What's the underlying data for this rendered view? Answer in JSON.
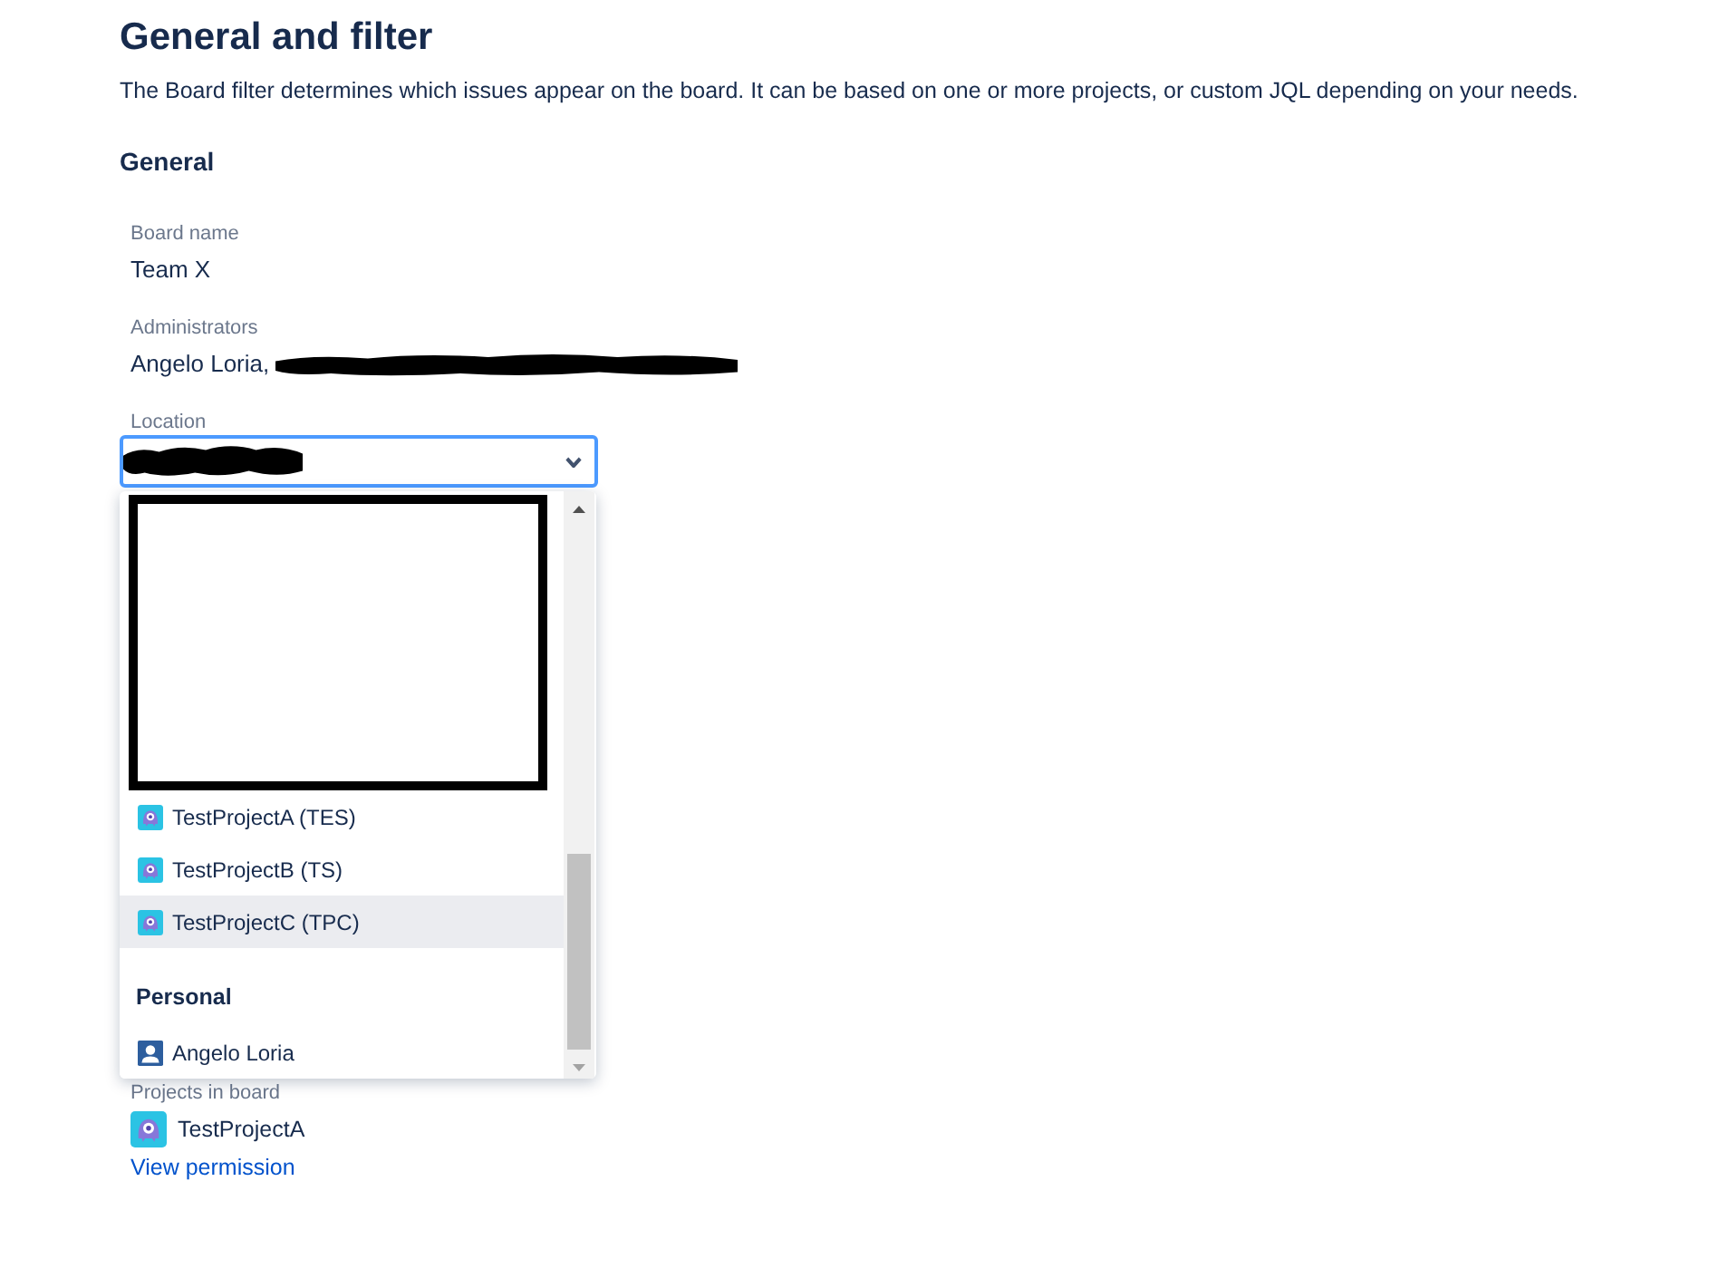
{
  "page": {
    "title": "General and filter",
    "description": "The Board filter determines which issues appear on the board. It can be based on one or more projects, or custom JQL depending on your needs."
  },
  "section": {
    "title": "General"
  },
  "fields": [
    {
      "kind": "text",
      "label": "Board name",
      "value": "Team X"
    },
    {
      "kind": "text",
      "label": "Administrators",
      "value": "Angelo Loria,",
      "redacted": true
    },
    {
      "kind": "select",
      "label": "Location",
      "redacted": true,
      "expanded": true
    }
  ],
  "location_menu": {
    "options": [
      {
        "kind": "redacted"
      },
      {
        "kind": "project",
        "label": "TestProjectA (TES)",
        "selected": false
      },
      {
        "kind": "project",
        "label": "TestProjectB (TS)",
        "selected": false
      },
      {
        "kind": "project",
        "label": "TestProjectC (TPC)",
        "selected": true
      },
      {
        "kind": "heading",
        "label": "Personal"
      },
      {
        "kind": "user",
        "label": "Angelo Loria",
        "selected": false
      }
    ]
  },
  "projects_in_board": {
    "label": "Projects in board",
    "projects": [
      {
        "name": "TestProjectA"
      }
    ],
    "link": "View permission"
  }
}
